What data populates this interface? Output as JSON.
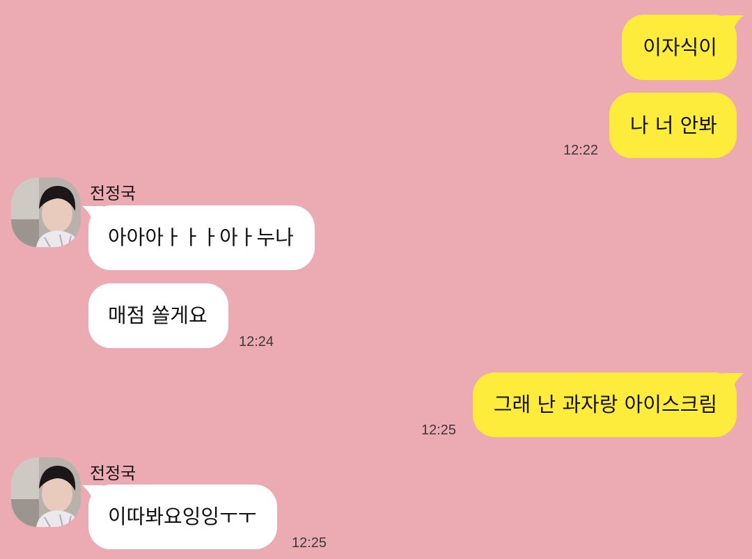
{
  "messages": [
    {
      "side": "me",
      "text": "이자식이"
    },
    {
      "side": "me",
      "text": "나 너 안봐",
      "time": "12:22"
    },
    {
      "side": "them",
      "sender": "전정국",
      "text": "아아아ㅏㅏㅏ아ㅏ누나"
    },
    {
      "side": "them",
      "text": "매점 쏠게요",
      "time": "12:24"
    },
    {
      "side": "me",
      "text": "그래 난 과자랑 아이스크림",
      "time": "12:25"
    },
    {
      "side": "them",
      "sender": "전정국",
      "text": "이따봐요잉잉ㅜㅜ",
      "time": "12:25"
    }
  ],
  "colors": {
    "background": "#ecaab2",
    "my_bubble": "#fdec3c",
    "their_bubble": "#ffffff"
  }
}
